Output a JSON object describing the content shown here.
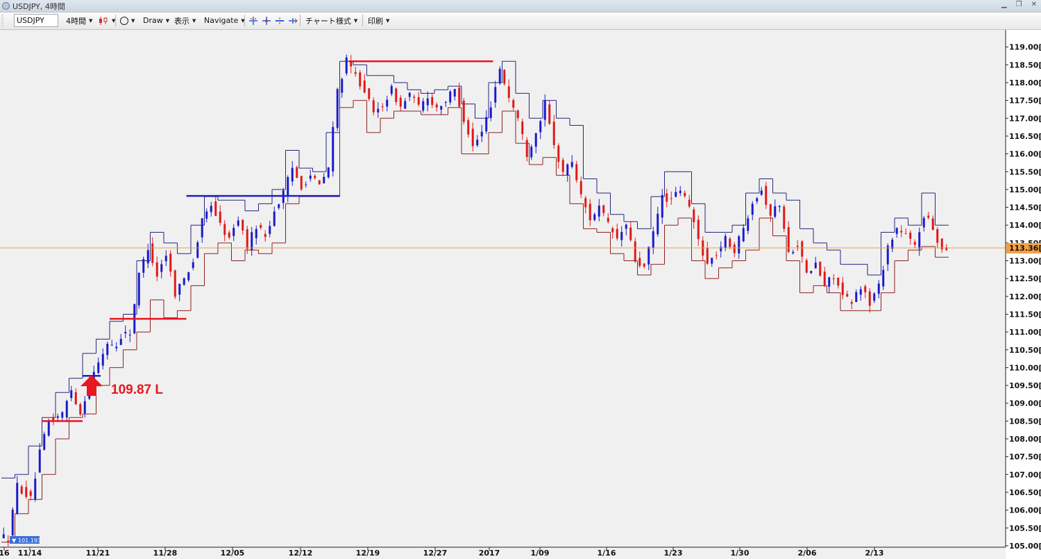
{
  "window": {
    "title": "USDJPY, 4時間"
  },
  "toolbar": {
    "symbol": "USDJPY",
    "timeframe": "4時間",
    "draw_label": "Draw",
    "view_label": "表示",
    "navigate_label": "Navigate",
    "chart_style_label": "チャート様式",
    "print_label": "印刷"
  },
  "chart_data": {
    "type": "candlestick",
    "symbol": "USDJPY",
    "timeframe": "4時間",
    "price_axis_ticks": [
      "118.50",
      "118.00",
      "117.50",
      "117.00",
      "116.50",
      "116.00",
      "115.50",
      "115.00",
      "114.50",
      "114.00",
      "113.50",
      "113.00",
      "112.50",
      "112.00",
      "111.50",
      "111.00",
      "110.50",
      "110.00",
      "109.50",
      "109.00",
      "108.50",
      "108.00",
      "107.50",
      "107.00",
      "106.50",
      "106.00",
      "105.50",
      "105.00"
    ],
    "price_axis_suffix": "[0",
    "top_partial_label": "119.00",
    "x_ticks": [
      "16",
      "11/14",
      "11/21",
      "11/28",
      "12/05",
      "12/12",
      "12/19",
      "12/27",
      "2017",
      "1/09",
      "1/16",
      "1/23",
      "1/30",
      "2/06",
      "2/13"
    ],
    "current_price_label": "113.36",
    "current_price": 113.36,
    "low_marker_label": "101.193",
    "annotation": {
      "text": "109.87 L",
      "price": 109.87
    },
    "price_path": [
      [
        0,
        105.3
      ],
      [
        2,
        105.2
      ],
      [
        4,
        106.7
      ],
      [
        7,
        106.3
      ],
      [
        9,
        107.6
      ],
      [
        11,
        108.5
      ],
      [
        14,
        108.7
      ],
      [
        16,
        109.4
      ],
      [
        18,
        108.7
      ],
      [
        20,
        109.6
      ],
      [
        22,
        110.1
      ],
      [
        24,
        110.7
      ],
      [
        26,
        110.6
      ],
      [
        27,
        110.9
      ],
      [
        29,
        111.0
      ],
      [
        31,
        112.6
      ],
      [
        33,
        113.4
      ],
      [
        35,
        112.6
      ],
      [
        37,
        113.2
      ],
      [
        39,
        112.1
      ],
      [
        41,
        112.5
      ],
      [
        43,
        113.0
      ],
      [
        45,
        114.1
      ],
      [
        47,
        114.6
      ],
      [
        49,
        114.0
      ],
      [
        51,
        113.6
      ],
      [
        53,
        114.2
      ],
      [
        55,
        113.4
      ],
      [
        57,
        114.0
      ],
      [
        59,
        113.7
      ],
      [
        61,
        114.4
      ],
      [
        63,
        114.9
      ],
      [
        65,
        115.6
      ],
      [
        67,
        115.1
      ],
      [
        69,
        115.4
      ],
      [
        71,
        115.1
      ],
      [
        73,
        115.6
      ],
      [
        75,
        117.8
      ],
      [
        77,
        118.6
      ],
      [
        79,
        118.2
      ],
      [
        81,
        117.8
      ],
      [
        83,
        117.1
      ],
      [
        85,
        117.4
      ],
      [
        87,
        117.8
      ],
      [
        89,
        117.3
      ],
      [
        91,
        117.7
      ],
      [
        93,
        117.3
      ],
      [
        95,
        117.6
      ],
      [
        97,
        117.3
      ],
      [
        99,
        117.5
      ],
      [
        101,
        117.8
      ],
      [
        103,
        117.0
      ],
      [
        105,
        116.2
      ],
      [
        107,
        116.6
      ],
      [
        109,
        117.4
      ],
      [
        111,
        118.4
      ],
      [
        113,
        117.6
      ],
      [
        115,
        117.0
      ],
      [
        117,
        116.0
      ],
      [
        119,
        116.6
      ],
      [
        121,
        117.4
      ],
      [
        123,
        116.2
      ],
      [
        125,
        115.5
      ],
      [
        127,
        115.8
      ],
      [
        129,
        114.8
      ],
      [
        131,
        114.2
      ],
      [
        133,
        114.5
      ],
      [
        135,
        114.0
      ],
      [
        137,
        113.6
      ],
      [
        139,
        114.0
      ],
      [
        141,
        113.0
      ],
      [
        143,
        112.8
      ],
      [
        145,
        113.8
      ],
      [
        147,
        114.8
      ],
      [
        149,
        114.7
      ],
      [
        151,
        115.0
      ],
      [
        153,
        114.5
      ],
      [
        155,
        113.6
      ],
      [
        157,
        112.9
      ],
      [
        159,
        113.2
      ],
      [
        161,
        113.6
      ],
      [
        163,
        113.3
      ],
      [
        165,
        113.9
      ],
      [
        167,
        114.7
      ],
      [
        169,
        115.0
      ],
      [
        171,
        114.3
      ],
      [
        173,
        114.6
      ],
      [
        175,
        113.2
      ],
      [
        177,
        113.5
      ],
      [
        179,
        112.6
      ],
      [
        181,
        112.9
      ],
      [
        183,
        112.3
      ],
      [
        185,
        112.6
      ],
      [
        187,
        112.0
      ],
      [
        189,
        111.8
      ],
      [
        191,
        112.3
      ],
      [
        193,
        111.8
      ],
      [
        195,
        112.3
      ],
      [
        197,
        113.4
      ],
      [
        199,
        113.9
      ],
      [
        201,
        113.7
      ],
      [
        203,
        113.4
      ],
      [
        205,
        114.3
      ],
      [
        207,
        113.9
      ],
      [
        209,
        113.3
      ],
      [
        210,
        113.4
      ]
    ],
    "bands": [
      {
        "from": 0,
        "to": 3,
        "high": 106.9,
        "low": 105.1
      },
      {
        "from": 3,
        "to": 6,
        "high": 107.0,
        "low": 105.9
      },
      {
        "from": 6,
        "to": 9,
        "high": 107.8,
        "low": 106.3
      },
      {
        "from": 9,
        "to": 12,
        "high": 108.6,
        "low": 107.0
      },
      {
        "from": 12,
        "to": 15,
        "high": 109.3,
        "low": 108.0
      },
      {
        "from": 15,
        "to": 18,
        "high": 109.7,
        "low": 108.6
      },
      {
        "from": 18,
        "to": 21,
        "high": 110.4,
        "low": 108.7
      },
      {
        "from": 21,
        "to": 24,
        "high": 110.8,
        "low": 109.5
      },
      {
        "from": 24,
        "to": 27,
        "high": 111.3,
        "low": 110.0
      },
      {
        "from": 27,
        "to": 30,
        "high": 111.5,
        "low": 110.5
      },
      {
        "from": 30,
        "to": 33,
        "high": 113.0,
        "low": 111.0
      },
      {
        "from": 33,
        "to": 36,
        "high": 113.8,
        "low": 111.9
      },
      {
        "from": 36,
        "to": 39,
        "high": 113.5,
        "low": 111.4
      },
      {
        "from": 39,
        "to": 42,
        "high": 113.2,
        "low": 111.6
      },
      {
        "from": 42,
        "to": 45,
        "high": 114.0,
        "low": 112.3
      },
      {
        "from": 45,
        "to": 48,
        "high": 114.8,
        "low": 113.2
      },
      {
        "from": 48,
        "to": 51,
        "high": 114.7,
        "low": 113.5
      },
      {
        "from": 51,
        "to": 54,
        "high": 114.7,
        "low": 113.0
      },
      {
        "from": 54,
        "to": 57,
        "high": 114.4,
        "low": 113.3
      },
      {
        "from": 57,
        "to": 60,
        "high": 114.6,
        "low": 113.2
      },
      {
        "from": 60,
        "to": 63,
        "high": 115.0,
        "low": 113.5
      },
      {
        "from": 63,
        "to": 66,
        "high": 116.1,
        "low": 114.6
      },
      {
        "from": 66,
        "to": 69,
        "high": 115.6,
        "low": 114.8
      },
      {
        "from": 69,
        "to": 72,
        "high": 115.5,
        "low": 114.8
      },
      {
        "from": 72,
        "to": 75,
        "high": 116.6,
        "low": 114.8
      },
      {
        "from": 75,
        "to": 78,
        "high": 118.6,
        "low": 117.3
      },
      {
        "from": 78,
        "to": 81,
        "high": 118.5,
        "low": 117.5
      },
      {
        "from": 81,
        "to": 84,
        "high": 118.2,
        "low": 116.6
      },
      {
        "from": 84,
        "to": 87,
        "high": 118.2,
        "low": 117.0
      },
      {
        "from": 87,
        "to": 90,
        "high": 118.0,
        "low": 117.2
      },
      {
        "from": 90,
        "to": 93,
        "high": 117.8,
        "low": 117.2
      },
      {
        "from": 93,
        "to": 96,
        "high": 117.7,
        "low": 117.1
      },
      {
        "from": 96,
        "to": 99,
        "high": 117.8,
        "low": 117.1
      },
      {
        "from": 99,
        "to": 102,
        "high": 117.9,
        "low": 117.3
      },
      {
        "from": 102,
        "to": 105,
        "high": 117.4,
        "low": 116.0
      },
      {
        "from": 105,
        "to": 108,
        "high": 117.0,
        "low": 116.0
      },
      {
        "from": 108,
        "to": 111,
        "high": 118.0,
        "low": 116.6
      },
      {
        "from": 111,
        "to": 114,
        "high": 118.6,
        "low": 117.2
      },
      {
        "from": 114,
        "to": 117,
        "high": 117.7,
        "low": 116.3
      },
      {
        "from": 117,
        "to": 120,
        "high": 117.0,
        "low": 115.7
      },
      {
        "from": 120,
        "to": 123,
        "high": 117.5,
        "low": 115.9
      },
      {
        "from": 123,
        "to": 126,
        "high": 117.0,
        "low": 115.4
      },
      {
        "from": 126,
        "to": 129,
        "high": 116.8,
        "low": 114.6
      },
      {
        "from": 129,
        "to": 132,
        "high": 115.3,
        "low": 113.9
      },
      {
        "from": 132,
        "to": 135,
        "high": 114.9,
        "low": 113.8
      },
      {
        "from": 135,
        "to": 138,
        "high": 114.3,
        "low": 113.2
      },
      {
        "from": 138,
        "to": 141,
        "high": 114.1,
        "low": 113.0
      },
      {
        "from": 141,
        "to": 144,
        "high": 113.9,
        "low": 112.6
      },
      {
        "from": 144,
        "to": 147,
        "high": 114.8,
        "low": 112.9
      },
      {
        "from": 147,
        "to": 150,
        "high": 115.5,
        "low": 114.0
      },
      {
        "from": 150,
        "to": 153,
        "high": 115.5,
        "low": 114.2
      },
      {
        "from": 153,
        "to": 156,
        "high": 114.6,
        "low": 113.0
      },
      {
        "from": 156,
        "to": 159,
        "high": 113.8,
        "low": 112.5
      },
      {
        "from": 159,
        "to": 162,
        "high": 113.8,
        "low": 112.8
      },
      {
        "from": 162,
        "to": 165,
        "high": 114.0,
        "low": 113.0
      },
      {
        "from": 165,
        "to": 168,
        "high": 114.9,
        "low": 113.3
      },
      {
        "from": 168,
        "to": 171,
        "high": 115.3,
        "low": 114.2
      },
      {
        "from": 171,
        "to": 174,
        "high": 114.9,
        "low": 113.7
      },
      {
        "from": 174,
        "to": 177,
        "high": 114.7,
        "low": 113.0
      },
      {
        "from": 177,
        "to": 180,
        "high": 113.9,
        "low": 112.1
      },
      {
        "from": 180,
        "to": 183,
        "high": 113.5,
        "low": 112.3
      },
      {
        "from": 183,
        "to": 186,
        "high": 113.3,
        "low": 112.1
      },
      {
        "from": 186,
        "to": 189,
        "high": 112.9,
        "low": 111.6
      },
      {
        "from": 189,
        "to": 192,
        "high": 112.9,
        "low": 111.6
      },
      {
        "from": 192,
        "to": 195,
        "high": 112.6,
        "low": 111.6
      },
      {
        "from": 195,
        "to": 198,
        "high": 113.8,
        "low": 112.1
      },
      {
        "from": 198,
        "to": 201,
        "high": 114.2,
        "low": 113.0
      },
      {
        "from": 201,
        "to": 204,
        "high": 114.0,
        "low": 113.3
      },
      {
        "from": 204,
        "to": 207,
        "high": 114.9,
        "low": 113.4
      },
      {
        "from": 207,
        "to": 210,
        "high": 114.0,
        "low": 113.1
      }
    ],
    "reference_lines": [
      {
        "price": 108.5,
        "from": 9,
        "to": 18,
        "color": "#e8161e"
      },
      {
        "price": 109.77,
        "from": 18,
        "to": 22,
        "color": "#2020c8"
      },
      {
        "price": 111.37,
        "from": 24,
        "to": 41,
        "color": "#e8161e"
      },
      {
        "price": 114.82,
        "from": 41,
        "to": 75,
        "color": "#2020c8"
      },
      {
        "price": 118.6,
        "from": 77,
        "to": 109,
        "color": "#e8161e"
      }
    ],
    "colors": {
      "up_candle": "#1a1acc",
      "down_candle": "#e01818",
      "band_high": "#25257e",
      "band_low": "#8b2020",
      "current_price_line": "#e8a040",
      "current_price_tag": "#f5a040",
      "annotation": "#e8161e",
      "background": "#f0f0f0",
      "axis_bg": "#ffffff",
      "low_marker": "#3b6fd6"
    }
  }
}
